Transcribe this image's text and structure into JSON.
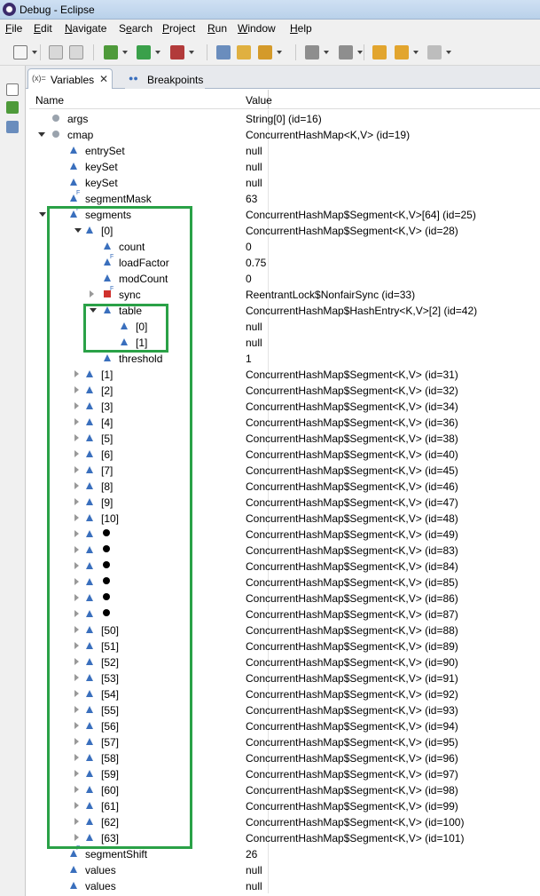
{
  "window": {
    "title": "Debug - Eclipse"
  },
  "menu": [
    "File",
    "Edit",
    "Navigate",
    "Search",
    "Project",
    "Run",
    "Window",
    "Help"
  ],
  "menu_mnemonic_index": [
    0,
    0,
    0,
    1,
    0,
    0,
    0,
    0
  ],
  "toolbar_icons": [
    "new-icon",
    "save-icon",
    "print-icon",
    "debug-icon",
    "run-icon",
    "external-tools-icon",
    "open-type-icon",
    "open-task-icon",
    "search-icon",
    "next-annotation-icon",
    "prev-annotation-icon",
    "last-edit-icon",
    "back-icon",
    "forward-icon"
  ],
  "tabs": [
    {
      "icon": "(x)=",
      "label": "Variables",
      "active": true
    },
    {
      "icon": "●●",
      "label": "Breakpoints",
      "active": false
    }
  ],
  "columns": {
    "name": "Name",
    "value": "Value"
  },
  "rows": [
    {
      "name": "args",
      "value": "String[0]  (id=16)",
      "depth": 0,
      "exp": "none",
      "icon": "grey",
      "final": false
    },
    {
      "name": "cmap",
      "value": "ConcurrentHashMap<K,V>  (id=19)",
      "depth": 0,
      "exp": "open",
      "icon": "grey",
      "final": false
    },
    {
      "name": "entrySet",
      "value": "null",
      "depth": 1,
      "exp": "none",
      "icon": "blue",
      "final": false
    },
    {
      "name": "keySet",
      "value": "null",
      "depth": 1,
      "exp": "none",
      "icon": "blue",
      "final": false
    },
    {
      "name": "keySet",
      "value": "null",
      "depth": 1,
      "exp": "none",
      "icon": "blue",
      "final": false
    },
    {
      "name": "segmentMask",
      "value": "63",
      "depth": 1,
      "exp": "none",
      "icon": "blue",
      "final": true
    },
    {
      "name": "segments",
      "value": "ConcurrentHashMap$Segment<K,V>[64]  (id=25)",
      "depth": 1,
      "exp": "open",
      "icon": "blue",
      "final": true
    },
    {
      "name": "[0]",
      "value": "ConcurrentHashMap$Segment<K,V>  (id=28)",
      "depth": 2,
      "exp": "open",
      "icon": "blue",
      "final": false
    },
    {
      "name": "count",
      "value": "0",
      "depth": 3,
      "exp": "none",
      "icon": "blue",
      "final": false
    },
    {
      "name": "loadFactor",
      "value": "0.75",
      "depth": 3,
      "exp": "none",
      "icon": "blue",
      "final": true
    },
    {
      "name": "modCount",
      "value": "0",
      "depth": 3,
      "exp": "none",
      "icon": "blue",
      "final": false
    },
    {
      "name": "sync",
      "value": "ReentrantLock$NonfairSync  (id=33)",
      "depth": 3,
      "exp": "closed",
      "icon": "red",
      "final": true
    },
    {
      "name": "table",
      "value": "ConcurrentHashMap$HashEntry<K,V>[2]  (id=42)",
      "depth": 3,
      "exp": "open",
      "icon": "blue",
      "final": false
    },
    {
      "name": "[0]",
      "value": "null",
      "depth": 4,
      "exp": "none",
      "icon": "blue",
      "final": false
    },
    {
      "name": "[1]",
      "value": "null",
      "depth": 4,
      "exp": "none",
      "icon": "blue",
      "final": false
    },
    {
      "name": "threshold",
      "value": "1",
      "depth": 3,
      "exp": "none",
      "icon": "blue",
      "final": false
    },
    {
      "name": "[1]",
      "value": "ConcurrentHashMap$Segment<K,V>  (id=31)",
      "depth": 2,
      "exp": "closed",
      "icon": "blue",
      "final": false
    },
    {
      "name": "[2]",
      "value": "ConcurrentHashMap$Segment<K,V>  (id=32)",
      "depth": 2,
      "exp": "closed",
      "icon": "blue",
      "final": false
    },
    {
      "name": "[3]",
      "value": "ConcurrentHashMap$Segment<K,V>  (id=34)",
      "depth": 2,
      "exp": "closed",
      "icon": "blue",
      "final": false
    },
    {
      "name": "[4]",
      "value": "ConcurrentHashMap$Segment<K,V>  (id=36)",
      "depth": 2,
      "exp": "closed",
      "icon": "blue",
      "final": false
    },
    {
      "name": "[5]",
      "value": "ConcurrentHashMap$Segment<K,V>  (id=38)",
      "depth": 2,
      "exp": "closed",
      "icon": "blue",
      "final": false
    },
    {
      "name": "[6]",
      "value": "ConcurrentHashMap$Segment<K,V>  (id=40)",
      "depth": 2,
      "exp": "closed",
      "icon": "blue",
      "final": false
    },
    {
      "name": "[7]",
      "value": "ConcurrentHashMap$Segment<K,V>  (id=45)",
      "depth": 2,
      "exp": "closed",
      "icon": "blue",
      "final": false
    },
    {
      "name": "[8]",
      "value": "ConcurrentHashMap$Segment<K,V>  (id=46)",
      "depth": 2,
      "exp": "closed",
      "icon": "blue",
      "final": false
    },
    {
      "name": "[9]",
      "value": "ConcurrentHashMap$Segment<K,V>  (id=47)",
      "depth": 2,
      "exp": "closed",
      "icon": "blue",
      "final": false
    },
    {
      "name": "[10]",
      "value": "ConcurrentHashMap$Segment<K,V>  (id=48)",
      "depth": 2,
      "exp": "closed",
      "icon": "blue",
      "final": false
    },
    {
      "name": "",
      "bullet": true,
      "value": "ConcurrentHashMap$Segment<K,V>  (id=49)",
      "depth": 2,
      "exp": "closed",
      "icon": "blue",
      "final": false
    },
    {
      "name": "",
      "bullet": true,
      "value": "ConcurrentHashMap$Segment<K,V>  (id=83)",
      "depth": 2,
      "exp": "closed",
      "icon": "blue",
      "final": false
    },
    {
      "name": "",
      "bullet": true,
      "value": "ConcurrentHashMap$Segment<K,V>  (id=84)",
      "depth": 2,
      "exp": "closed",
      "icon": "blue",
      "final": false
    },
    {
      "name": "",
      "bullet": true,
      "value": "ConcurrentHashMap$Segment<K,V>  (id=85)",
      "depth": 2,
      "exp": "closed",
      "icon": "blue",
      "final": false
    },
    {
      "name": "",
      "bullet": true,
      "value": "ConcurrentHashMap$Segment<K,V>  (id=86)",
      "depth": 2,
      "exp": "closed",
      "icon": "blue",
      "final": false
    },
    {
      "name": "",
      "bullet": true,
      "value": "ConcurrentHashMap$Segment<K,V>  (id=87)",
      "depth": 2,
      "exp": "closed",
      "icon": "blue",
      "final": false
    },
    {
      "name": "[50]",
      "value": "ConcurrentHashMap$Segment<K,V>  (id=88)",
      "depth": 2,
      "exp": "closed",
      "icon": "blue",
      "final": false
    },
    {
      "name": "[51]",
      "value": "ConcurrentHashMap$Segment<K,V>  (id=89)",
      "depth": 2,
      "exp": "closed",
      "icon": "blue",
      "final": false
    },
    {
      "name": "[52]",
      "value": "ConcurrentHashMap$Segment<K,V>  (id=90)",
      "depth": 2,
      "exp": "closed",
      "icon": "blue",
      "final": false
    },
    {
      "name": "[53]",
      "value": "ConcurrentHashMap$Segment<K,V>  (id=91)",
      "depth": 2,
      "exp": "closed",
      "icon": "blue",
      "final": false
    },
    {
      "name": "[54]",
      "value": "ConcurrentHashMap$Segment<K,V>  (id=92)",
      "depth": 2,
      "exp": "closed",
      "icon": "blue",
      "final": false
    },
    {
      "name": "[55]",
      "value": "ConcurrentHashMap$Segment<K,V>  (id=93)",
      "depth": 2,
      "exp": "closed",
      "icon": "blue",
      "final": false
    },
    {
      "name": "[56]",
      "value": "ConcurrentHashMap$Segment<K,V>  (id=94)",
      "depth": 2,
      "exp": "closed",
      "icon": "blue",
      "final": false
    },
    {
      "name": "[57]",
      "value": "ConcurrentHashMap$Segment<K,V>  (id=95)",
      "depth": 2,
      "exp": "closed",
      "icon": "blue",
      "final": false
    },
    {
      "name": "[58]",
      "value": "ConcurrentHashMap$Segment<K,V>  (id=96)",
      "depth": 2,
      "exp": "closed",
      "icon": "blue",
      "final": false
    },
    {
      "name": "[59]",
      "value": "ConcurrentHashMap$Segment<K,V>  (id=97)",
      "depth": 2,
      "exp": "closed",
      "icon": "blue",
      "final": false
    },
    {
      "name": "[60]",
      "value": "ConcurrentHashMap$Segment<K,V>  (id=98)",
      "depth": 2,
      "exp": "closed",
      "icon": "blue",
      "final": false
    },
    {
      "name": "[61]",
      "value": "ConcurrentHashMap$Segment<K,V>  (id=99)",
      "depth": 2,
      "exp": "closed",
      "icon": "blue",
      "final": false
    },
    {
      "name": "[62]",
      "value": "ConcurrentHashMap$Segment<K,V>  (id=100)",
      "depth": 2,
      "exp": "closed",
      "icon": "blue",
      "final": false
    },
    {
      "name": "[63]",
      "value": "ConcurrentHashMap$Segment<K,V>  (id=101)",
      "depth": 2,
      "exp": "closed",
      "icon": "blue",
      "final": false
    },
    {
      "name": "segmentShift",
      "value": "26",
      "depth": 1,
      "exp": "none",
      "icon": "blue",
      "final": true
    },
    {
      "name": "values",
      "value": "null",
      "depth": 1,
      "exp": "none",
      "icon": "blue",
      "final": false
    },
    {
      "name": "values",
      "value": "null",
      "depth": 1,
      "exp": "none",
      "icon": "blue",
      "final": false
    }
  ],
  "colors": {
    "highlight": "#2aa147",
    "accent": "#3a6fbd"
  }
}
